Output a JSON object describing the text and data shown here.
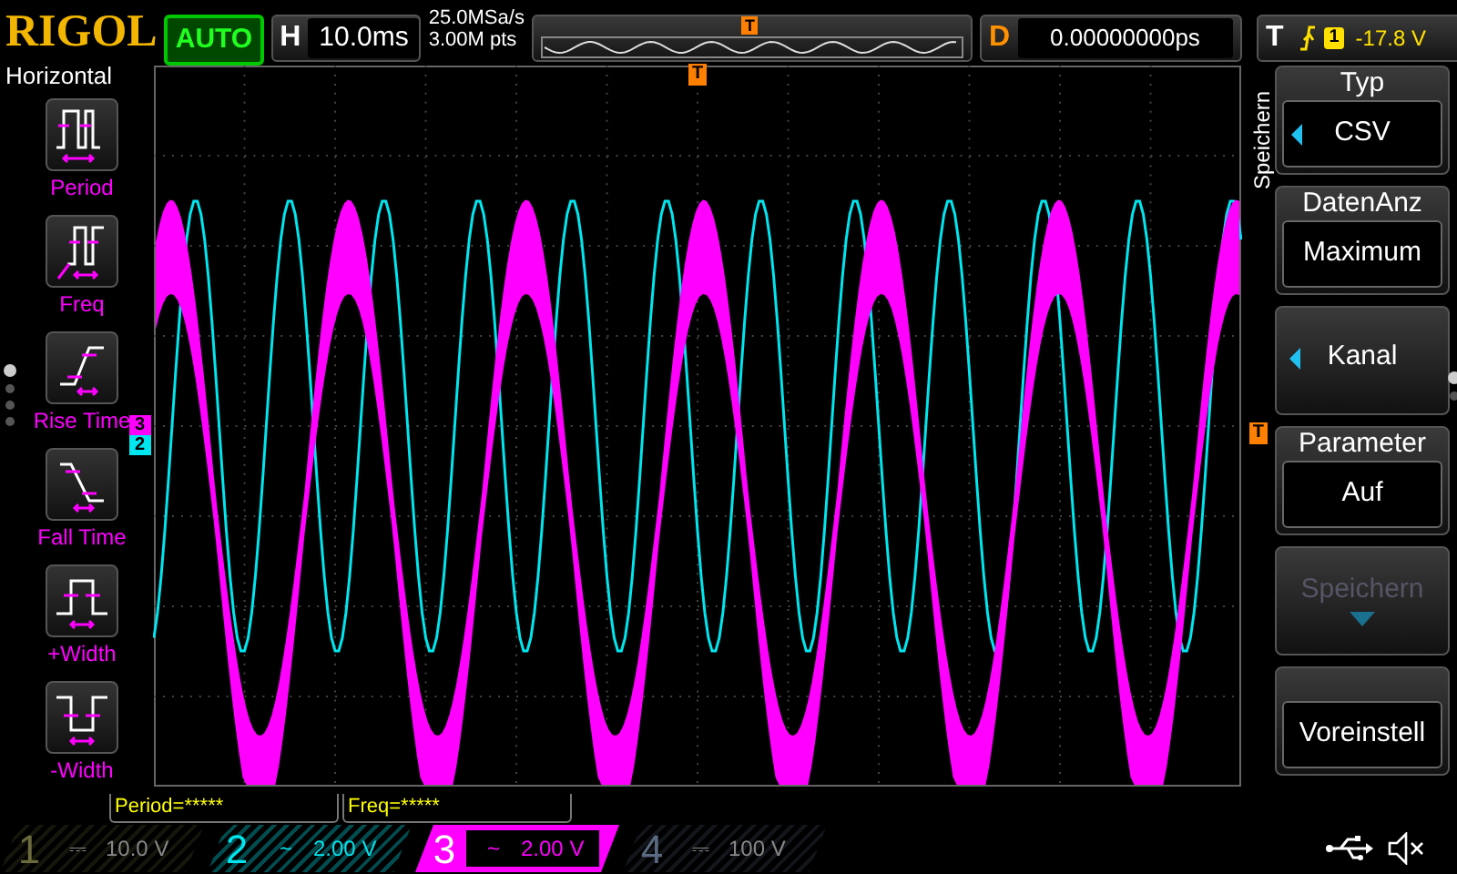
{
  "top_bar": {
    "logo": "RIGOL",
    "run_status": "AUTO",
    "horizontal": {
      "label": "H",
      "timebase": "10.0ms",
      "sample_rate": "25.0MSa/s",
      "memory_depth": "3.00M pts",
      "marker": "T"
    },
    "delay": {
      "label": "D",
      "value": "0.00000000ps"
    },
    "trigger": {
      "label": "T",
      "source": "1",
      "level": "-17.8 V"
    }
  },
  "left_menu": {
    "title": "Horizontal",
    "pages": [
      {
        "selected": true
      },
      {
        "selected": false
      },
      {
        "selected": false
      },
      {
        "selected": false
      }
    ],
    "items": [
      {
        "kind": "period",
        "label": "Period"
      },
      {
        "kind": "freq",
        "label": "Freq"
      },
      {
        "kind": "rise",
        "label": "Rise Time"
      },
      {
        "kind": "fall",
        "label": "Fall Time"
      },
      {
        "kind": "pwidth",
        "label": "+Width"
      },
      {
        "kind": "nwidth",
        "label": "-Width"
      }
    ]
  },
  "display": {
    "trigger_position_marker": "T",
    "trigger_level_marker": "T",
    "channel_markers": [
      {
        "label": "3",
        "color": "#ff00ff"
      },
      {
        "label": "2",
        "color": "#00e5ee"
      }
    ]
  },
  "measurements": [
    "Period=*****",
    "Freq=*****"
  ],
  "right_menu": {
    "title": "Speichern",
    "pages": [
      {
        "selected": true
      },
      {
        "selected": false
      }
    ],
    "items": [
      {
        "kind": "labeled",
        "title": "Typ",
        "value": "CSV",
        "selector": true,
        "disabled": false,
        "dropdown": false
      },
      {
        "kind": "labeled",
        "title": "DatenAnz",
        "value": "Maximum",
        "selector": false,
        "disabled": false,
        "dropdown": false
      },
      {
        "kind": "single",
        "value": "Kanal",
        "selector": true,
        "disabled": false,
        "dropdown": false
      },
      {
        "kind": "labeled",
        "title": "Parameter",
        "value": "Auf",
        "selector": false,
        "disabled": false,
        "dropdown": false
      },
      {
        "kind": "single",
        "value": "Speichern",
        "selector": false,
        "disabled": true,
        "dropdown": true
      },
      {
        "kind": "labeled",
        "value": "Voreinstell",
        "selector": false,
        "disabled": false,
        "dropdown": false
      }
    ]
  },
  "channels": [
    {
      "number": "1",
      "coupling": "⎓",
      "scale": "10.0 V",
      "on": false,
      "selected": false,
      "color": "#6b6b3c"
    },
    {
      "number": "2",
      "coupling": "~",
      "scale": "2.00 V",
      "on": true,
      "selected": false,
      "color": "#00e5ee"
    },
    {
      "number": "3",
      "coupling": "~",
      "scale": "2.00 V",
      "on": true,
      "selected": true,
      "color": "#ff00ff"
    },
    {
      "number": "4",
      "coupling": "⎓",
      "scale": "100 V",
      "on": false,
      "selected": false,
      "color": "#5a6a80"
    }
  ]
}
